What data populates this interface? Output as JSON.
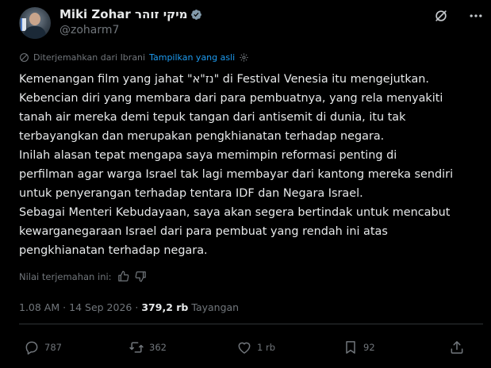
{
  "author": {
    "display_name": "Miki Zohar מיקי זוהר",
    "handle": "@zoharm7",
    "avatar_icon": "profile-photo"
  },
  "translation": {
    "note": "Diterjemahkan dari Ibrani",
    "show_original": "Tampilkan yang asli"
  },
  "post": {
    "lines": [
      "Kemenangan film yang jahat \"נז\"א\" di Festival Venesia itu mengejutkan.",
      "Kebencian diri yang membara dari para pembuatnya, yang rela menyakiti",
      "tanah air mereka demi tepuk tangan dari antisemit di dunia, itu tak",
      "terbayangkan dan merupakan pengkhianatan terhadap negara.",
      "Inilah alasan tepat mengapa saya memimpin reformasi penting di",
      "perfilman agar warga Israel tak lagi membayar dari kantong mereka sendiri",
      "untuk penyerangan terhadap tentara IDF dan Negara Israel.",
      "Sebagai Menteri Kebudayaan, saya akan segera bertindak untuk mencabut",
      "kewarganegaraan Israel dari para pembuat yang rendah ini atas",
      "pengkhianatan terhadap negara."
    ]
  },
  "rating": {
    "label": "Nilai terjemahan ini:"
  },
  "meta": {
    "time": "1.08 AM",
    "separator": "·",
    "date": "14 Sep 2026",
    "views_count": "379,2 rb",
    "views_label": "Tayangan"
  },
  "actions": {
    "replies": "787",
    "reposts": "362",
    "likes": "1 rb",
    "bookmarks": "92"
  },
  "colors": {
    "background": "#000000",
    "text": "#e7e9ea",
    "muted": "#71767b",
    "link": "#1d9bf0",
    "verified": "#829aab"
  }
}
